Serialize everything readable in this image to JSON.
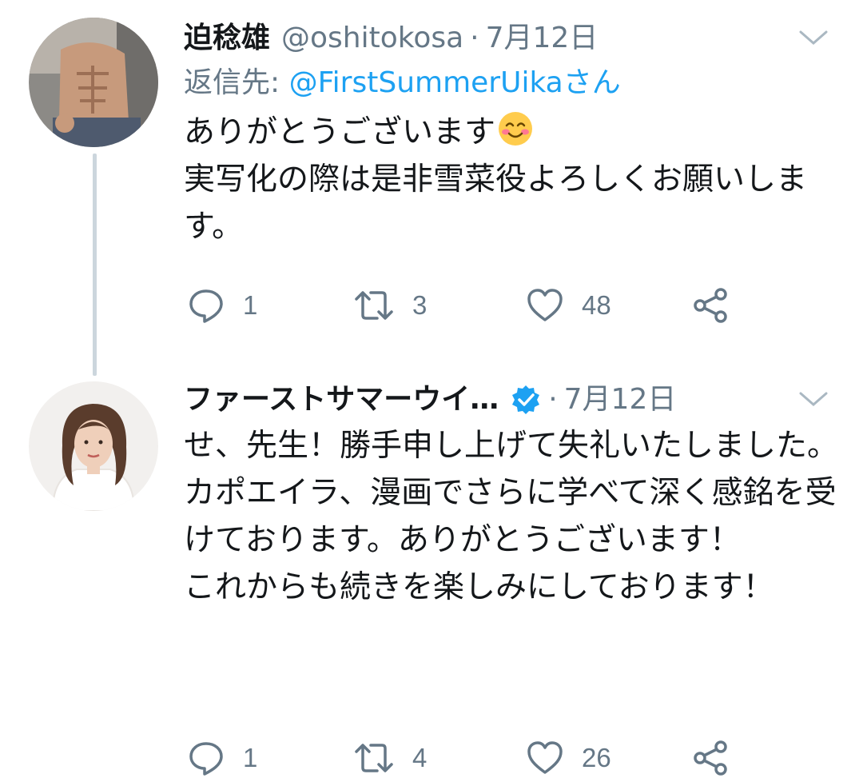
{
  "tweets": [
    {
      "display_name": "迫稔雄",
      "handle": "@oshitokosa",
      "separator": "·",
      "date": "7月12日",
      "reply_prefix": "返信先: ",
      "reply_mention": "@FirstSummerUikaさん",
      "body_line1": "ありがとうございます",
      "body_emoji": "smiling-face-with-smiling-eyes-icon",
      "body_rest": "実写化の際は是非雪菜役よろしくお願いします。",
      "replies": "1",
      "retweets": "3",
      "likes": "48",
      "verified": false
    },
    {
      "display_name": "ファーストサマーウイ…",
      "handle": "",
      "separator": "·",
      "date": "7月12日",
      "body": "せ、先生！勝手申し上げて失礼いたしました。カポエイラ、漫画でさらに学べて深く感銘を受けております。ありがとうございます！\nこれからも続きを楽しみにしております！",
      "replies": "1",
      "retweets": "4",
      "likes": "26",
      "verified": true
    }
  ],
  "colors": {
    "text": "#14171a",
    "secondary": "#657786",
    "link": "#1da1f2",
    "thread_line": "#ccd6dd"
  },
  "icons": {
    "reply": "reply-icon",
    "retweet": "retweet-icon",
    "like": "heart-icon",
    "share": "share-icon",
    "menu": "chevron-down-icon",
    "verified": "verified-badge-icon"
  }
}
